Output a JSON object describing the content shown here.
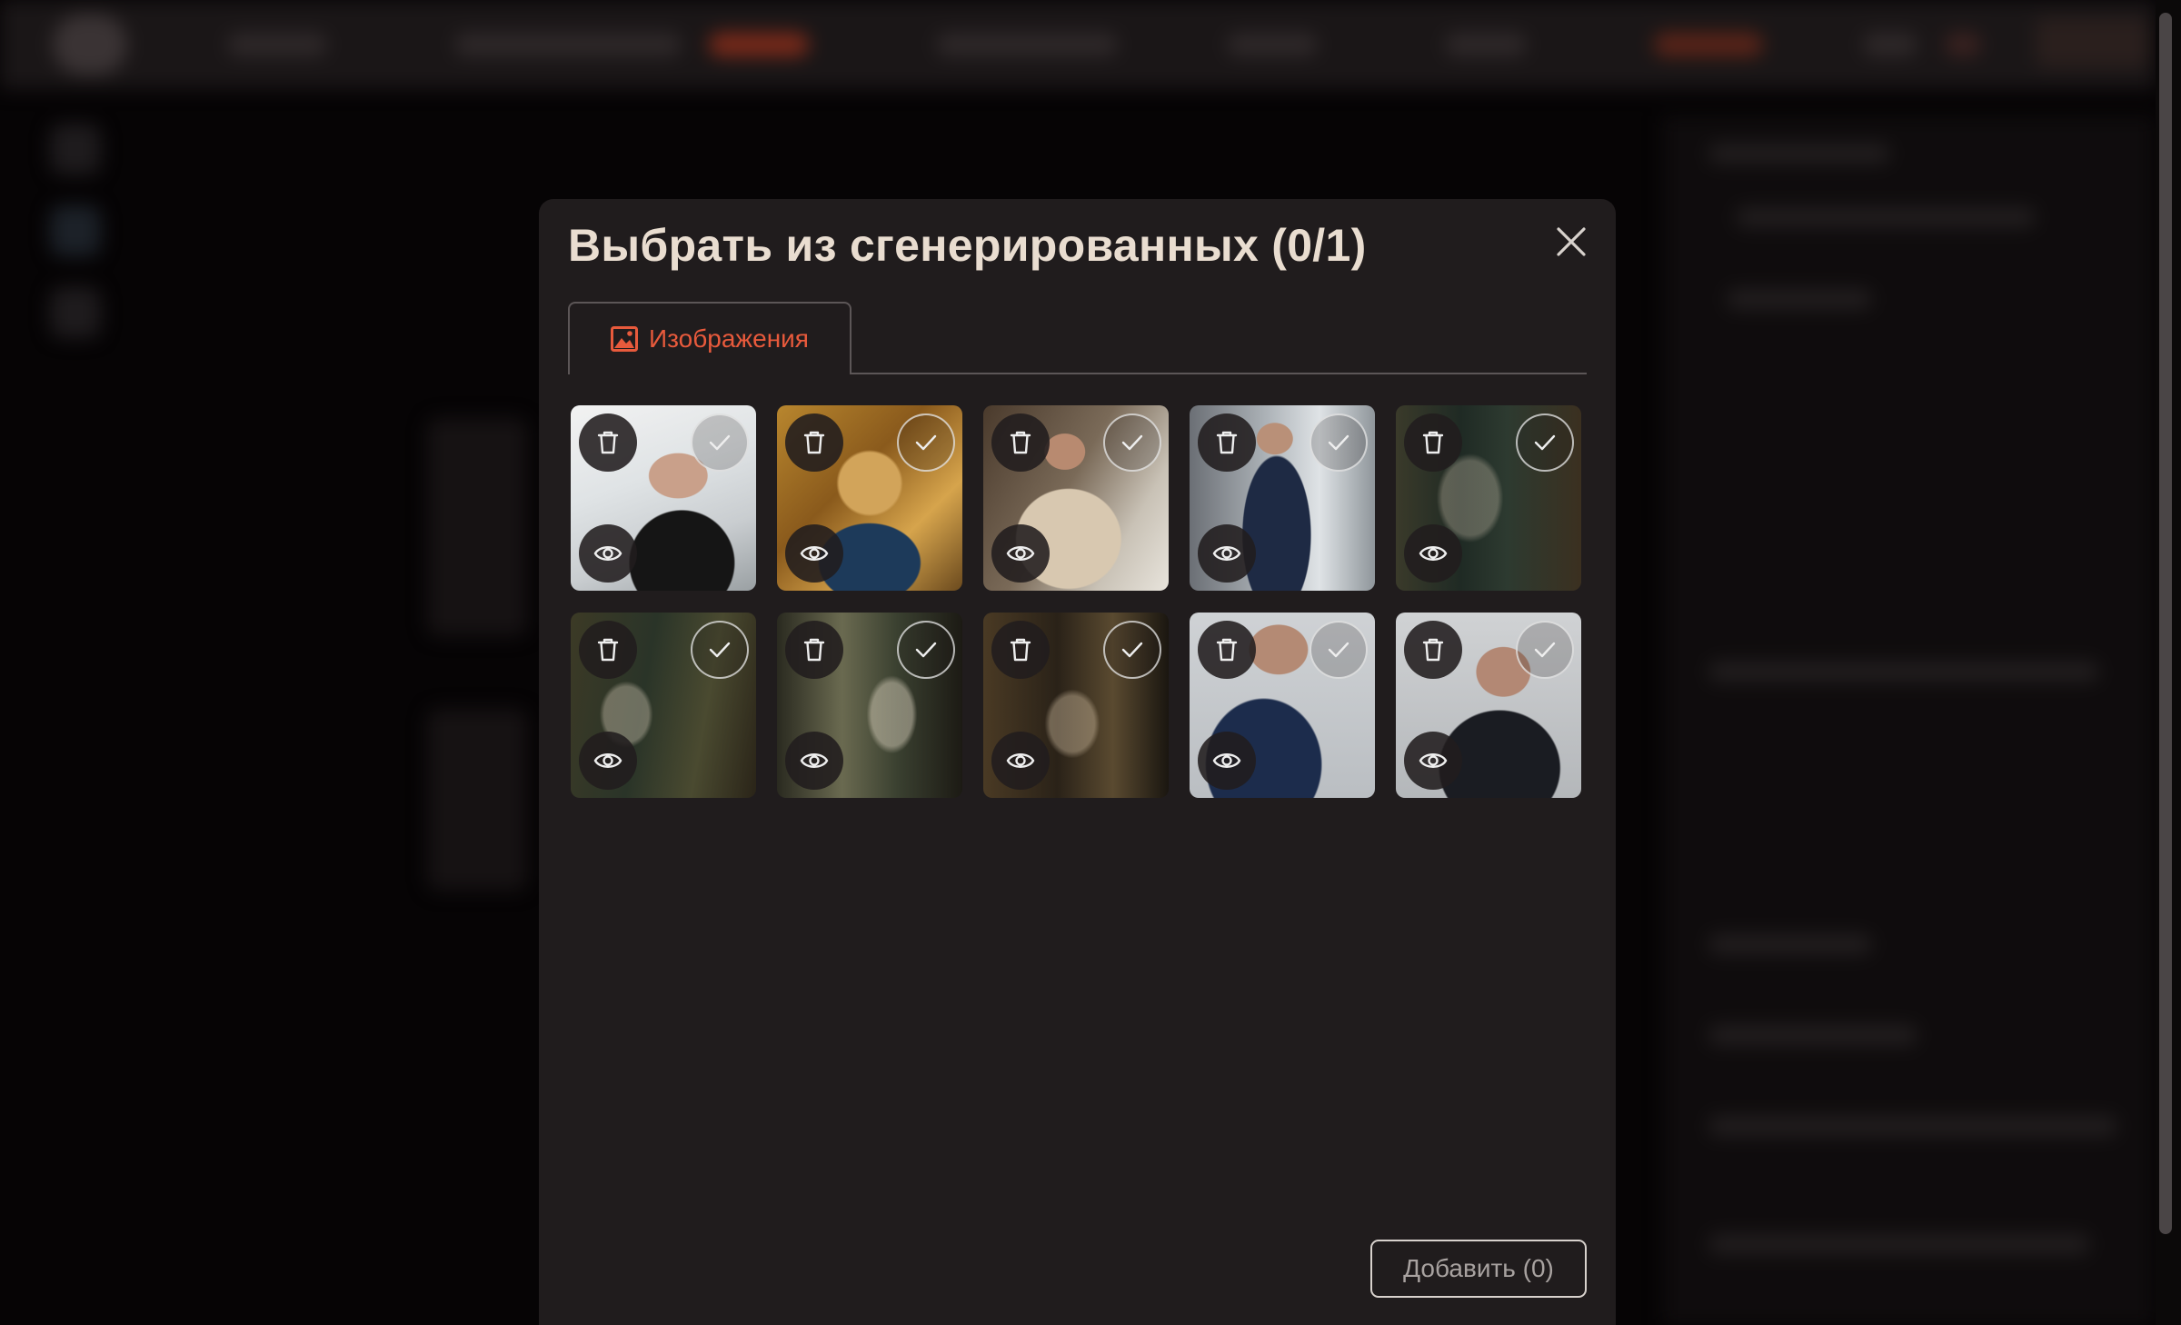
{
  "modal": {
    "title": "Выбрать из сгенерированных (0/1)",
    "tab_label": "Изображения",
    "add_button_label": "Добавить (0)",
    "accent_color": "#e85a3c"
  },
  "images": [
    {
      "subject": "bearded man in leather jacket with laptop and studio camera",
      "selected": false
    },
    {
      "subject": "stylized golden portrait of bearded man",
      "selected": false
    },
    {
      "subject": "man in beige sweater in a cafe",
      "selected": false
    },
    {
      "subject": "man in navy suit in office",
      "selected": false
    },
    {
      "subject": "dim coffee shop interior with steam",
      "selected": false
    },
    {
      "subject": "coffee shop interior with window light and steam",
      "selected": false
    },
    {
      "subject": "steaming cup near window",
      "selected": false
    },
    {
      "subject": "cafe counter with coffee machine and steam",
      "selected": false
    },
    {
      "subject": "man in navy blazer, grey background",
      "selected": false
    },
    {
      "subject": "man in dark suit, grey background",
      "selected": false
    }
  ]
}
